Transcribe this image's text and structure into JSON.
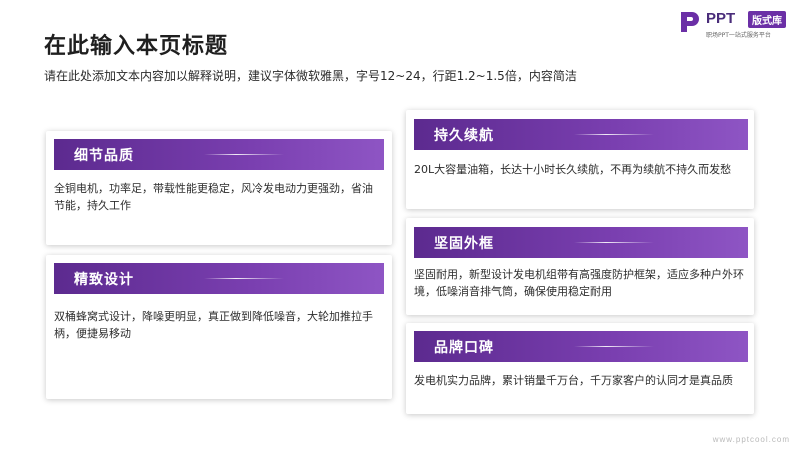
{
  "header": {
    "title": "在此输入本页标题",
    "subtitle": "请在此处添加文本内容加以解释说明，建议字体微软雅黑，字号12~24，行距1.2~1.5倍，内容简洁"
  },
  "logo": {
    "word": "PPT",
    "badge": "版式库",
    "tagline": "职场PPT一站式服务平台",
    "icon": "ppt-logo-icon"
  },
  "cards": {
    "left": [
      {
        "title": "细节品质",
        "text": "全铜电机，功率足，带载性能更稳定，风冷发电动力更强劲，省油节能，持久工作"
      },
      {
        "title": "精致设计",
        "text": "双桶蜂窝式设计，降噪更明显，真正做到降低噪音，大轮加推拉手柄，便捷易移动"
      }
    ],
    "right": [
      {
        "title": "持久续航",
        "text": "20L大容量油箱，长达十小时长久续航，不再为续航不持久而发愁"
      },
      {
        "title": "坚固外框",
        "text": "坚固耐用，新型设计发电机组带有高强度防护框架，适应多种户外环境，低噪消音排气筒，确保使用稳定耐用"
      },
      {
        "title": "品牌口碑",
        "text": "发电机实力品牌，累计销量千万台，千万家客户的认同才是真品质"
      }
    ]
  },
  "footer": {
    "site": "www.pptcool.com"
  },
  "colors": {
    "accent": "#6b2fa6",
    "band_start": "#5c2a8f",
    "band_end": "#8e55c4"
  }
}
